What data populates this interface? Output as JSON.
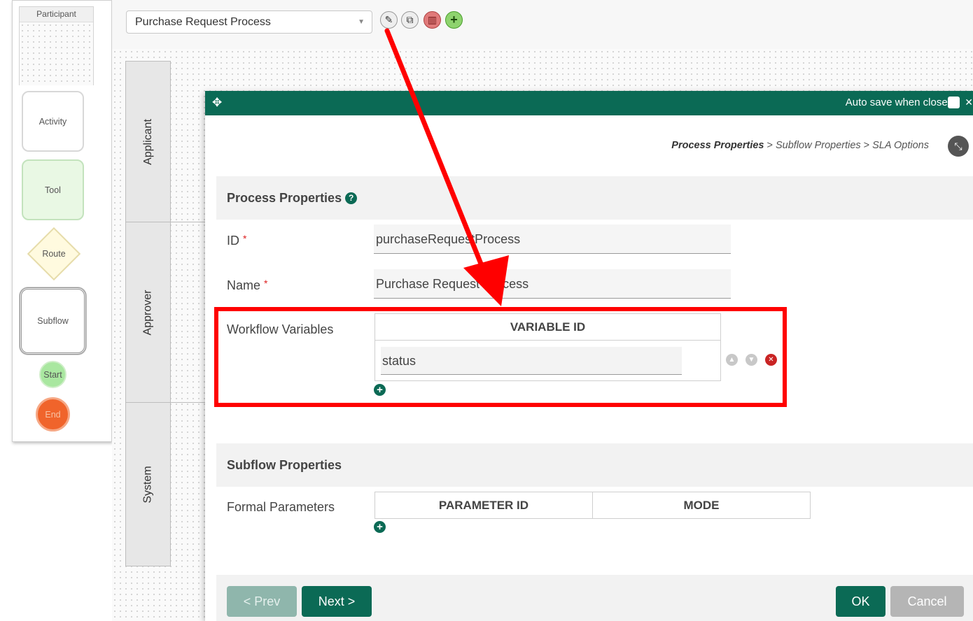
{
  "palette": {
    "participant": "Participant",
    "activity": "Activity",
    "tool": "Tool",
    "route": "Route",
    "subflow": "Subflow",
    "start": "Start",
    "end": "End"
  },
  "toolbar": {
    "process_select": "Purchase Request Process",
    "icons": [
      "pencil-icon",
      "copy-icon",
      "trash-icon",
      "plus-icon"
    ]
  },
  "lanes": [
    "Applicant",
    "Approver",
    "System"
  ],
  "dialog": {
    "autosave_label": "Auto save when close?",
    "breadcrumb": {
      "current": "Process Properties",
      "step2": "Subflow Properties",
      "step3": "SLA Options",
      "separator": ">"
    },
    "process_properties": {
      "title": "Process Properties",
      "id_label": "ID",
      "id_value": "purchaseRequestProcess",
      "name_label": "Name",
      "name_value": "Purchase Request Process",
      "required_mark": "*",
      "workflow_variables_label": "Workflow Variables",
      "variable_header": "VARIABLE ID",
      "variables": [
        "status"
      ]
    },
    "subflow_properties": {
      "title": "Subflow Properties",
      "formal_parameters_label": "Formal Parameters",
      "columns": [
        "PARAMETER ID",
        "MODE"
      ]
    },
    "buttons": {
      "prev": "< Prev",
      "next": "Next >",
      "ok": "OK",
      "cancel": "Cancel"
    }
  },
  "colors": {
    "brand_green": "#0b6a55",
    "annotation_red": "#ff0000"
  }
}
